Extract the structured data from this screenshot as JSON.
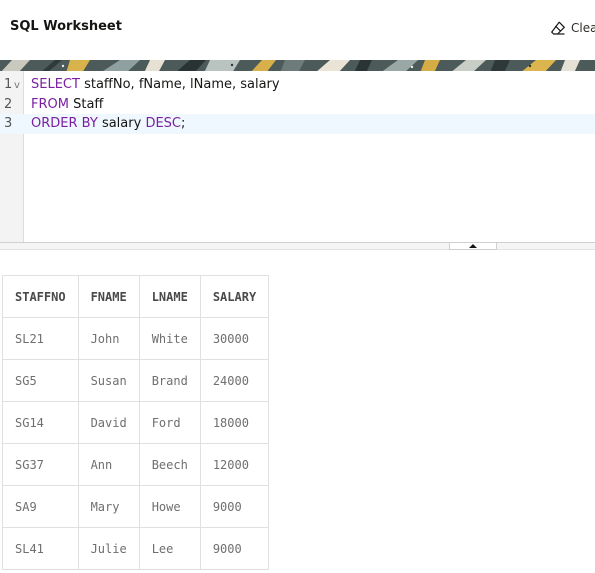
{
  "worksheet": {
    "title": "SQL Worksheet",
    "clear_label": "Clear"
  },
  "editor": {
    "lines": [
      {
        "num": "1",
        "fold": "v",
        "tokens": [
          {
            "t": "SELECT",
            "kw": true
          },
          {
            "t": " staffNo, fName, lName, salary",
            "kw": false
          }
        ]
      },
      {
        "num": "2",
        "fold": "",
        "tokens": [
          {
            "t": "FROM",
            "kw": true
          },
          {
            "t": " Staff",
            "kw": false
          }
        ]
      },
      {
        "num": "3",
        "fold": "",
        "tokens": [
          {
            "t": "ORDER BY",
            "kw": true
          },
          {
            "t": " salary ",
            "kw": false
          },
          {
            "t": "DESC",
            "kw": true
          },
          {
            "t": ";",
            "kw": false
          }
        ]
      }
    ]
  },
  "results": {
    "columns": [
      "STAFFNO",
      "FNAME",
      "LNAME",
      "SALARY"
    ],
    "rows": [
      [
        "SL21",
        "John",
        "White",
        "30000"
      ],
      [
        "SG5",
        "Susan",
        "Brand",
        "24000"
      ],
      [
        "SG14",
        "David",
        "Ford",
        "18000"
      ],
      [
        "SG37",
        "Ann",
        "Beech",
        "12000"
      ],
      [
        "SA9",
        "Mary",
        "Howe",
        "9000"
      ],
      [
        "SL41",
        "Julie",
        "Lee",
        "9000"
      ]
    ]
  },
  "colors": {
    "keyword": "#7b1fa2",
    "active_line": "#eef8fe",
    "gutter": "#f3f3f3"
  }
}
